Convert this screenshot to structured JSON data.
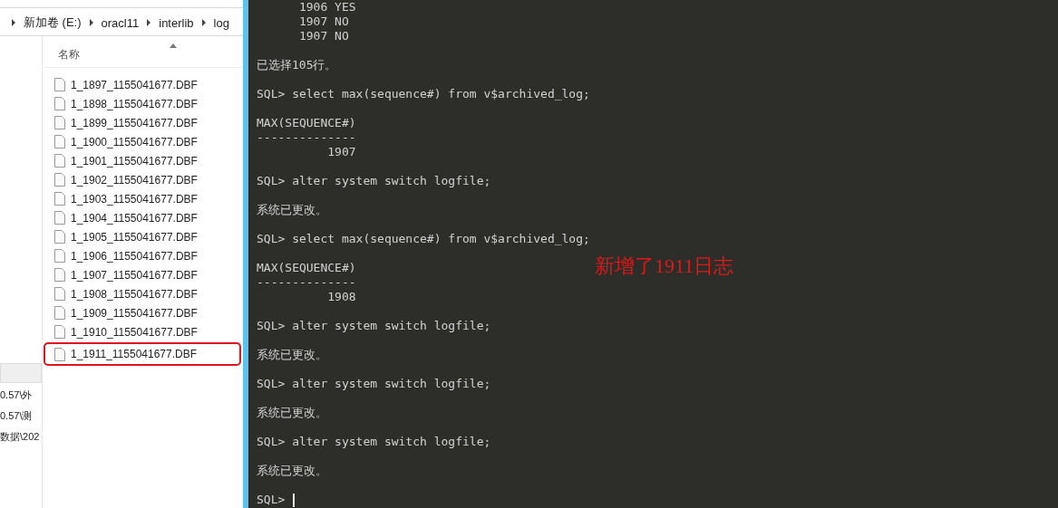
{
  "explorer": {
    "breadcrumb": [
      "新加卷 (E:)",
      "oracl11",
      "interlib",
      "log"
    ],
    "column_header": "名称",
    "files": [
      {
        "name": "1_1897_1155041677.DBF",
        "highlighted": false
      },
      {
        "name": "1_1898_1155041677.DBF",
        "highlighted": false
      },
      {
        "name": "1_1899_1155041677.DBF",
        "highlighted": false
      },
      {
        "name": "1_1900_1155041677.DBF",
        "highlighted": false
      },
      {
        "name": "1_1901_1155041677.DBF",
        "highlighted": false
      },
      {
        "name": "1_1902_1155041677.DBF",
        "highlighted": false
      },
      {
        "name": "1_1903_1155041677.DBF",
        "highlighted": false
      },
      {
        "name": "1_1904_1155041677.DBF",
        "highlighted": false
      },
      {
        "name": "1_1905_1155041677.DBF",
        "highlighted": false
      },
      {
        "name": "1_1906_1155041677.DBF",
        "highlighted": false
      },
      {
        "name": "1_1907_1155041677.DBF",
        "highlighted": false
      },
      {
        "name": "1_1908_1155041677.DBF",
        "highlighted": false
      },
      {
        "name": "1_1909_1155041677.DBF",
        "highlighted": false
      },
      {
        "name": "1_1910_1155041677.DBF",
        "highlighted": false
      },
      {
        "name": "1_1911_1155041677.DBF",
        "highlighted": true
      }
    ],
    "nav_items": [
      "0.57\\外",
      "0.57\\测",
      "数据\\202"
    ]
  },
  "terminal": {
    "blocks": [
      [
        "      1906 YES",
        "      1907 NO",
        "      1907 NO"
      ],
      [
        "已选择105行。"
      ],
      [
        "SQL> select max(sequence#) from v$archived_log;"
      ],
      [
        "MAX(SEQUENCE#)",
        "--------------",
        "          1907"
      ],
      [
        "SQL> alter system switch logfile;"
      ],
      [
        "系统已更改。"
      ],
      [
        "SQL> select max(sequence#) from v$archived_log;"
      ],
      [
        "MAX(SEQUENCE#)",
        "--------------",
        "          1908"
      ],
      [
        "SQL> alter system switch logfile;"
      ],
      [
        "系统已更改。"
      ],
      [
        "SQL> alter system switch logfile;"
      ],
      [
        "系统已更改。"
      ],
      [
        "SQL> alter system switch logfile;"
      ],
      [
        "系统已更改。"
      ],
      [
        "SQL> "
      ]
    ],
    "annotation": "新增了1911日志"
  }
}
